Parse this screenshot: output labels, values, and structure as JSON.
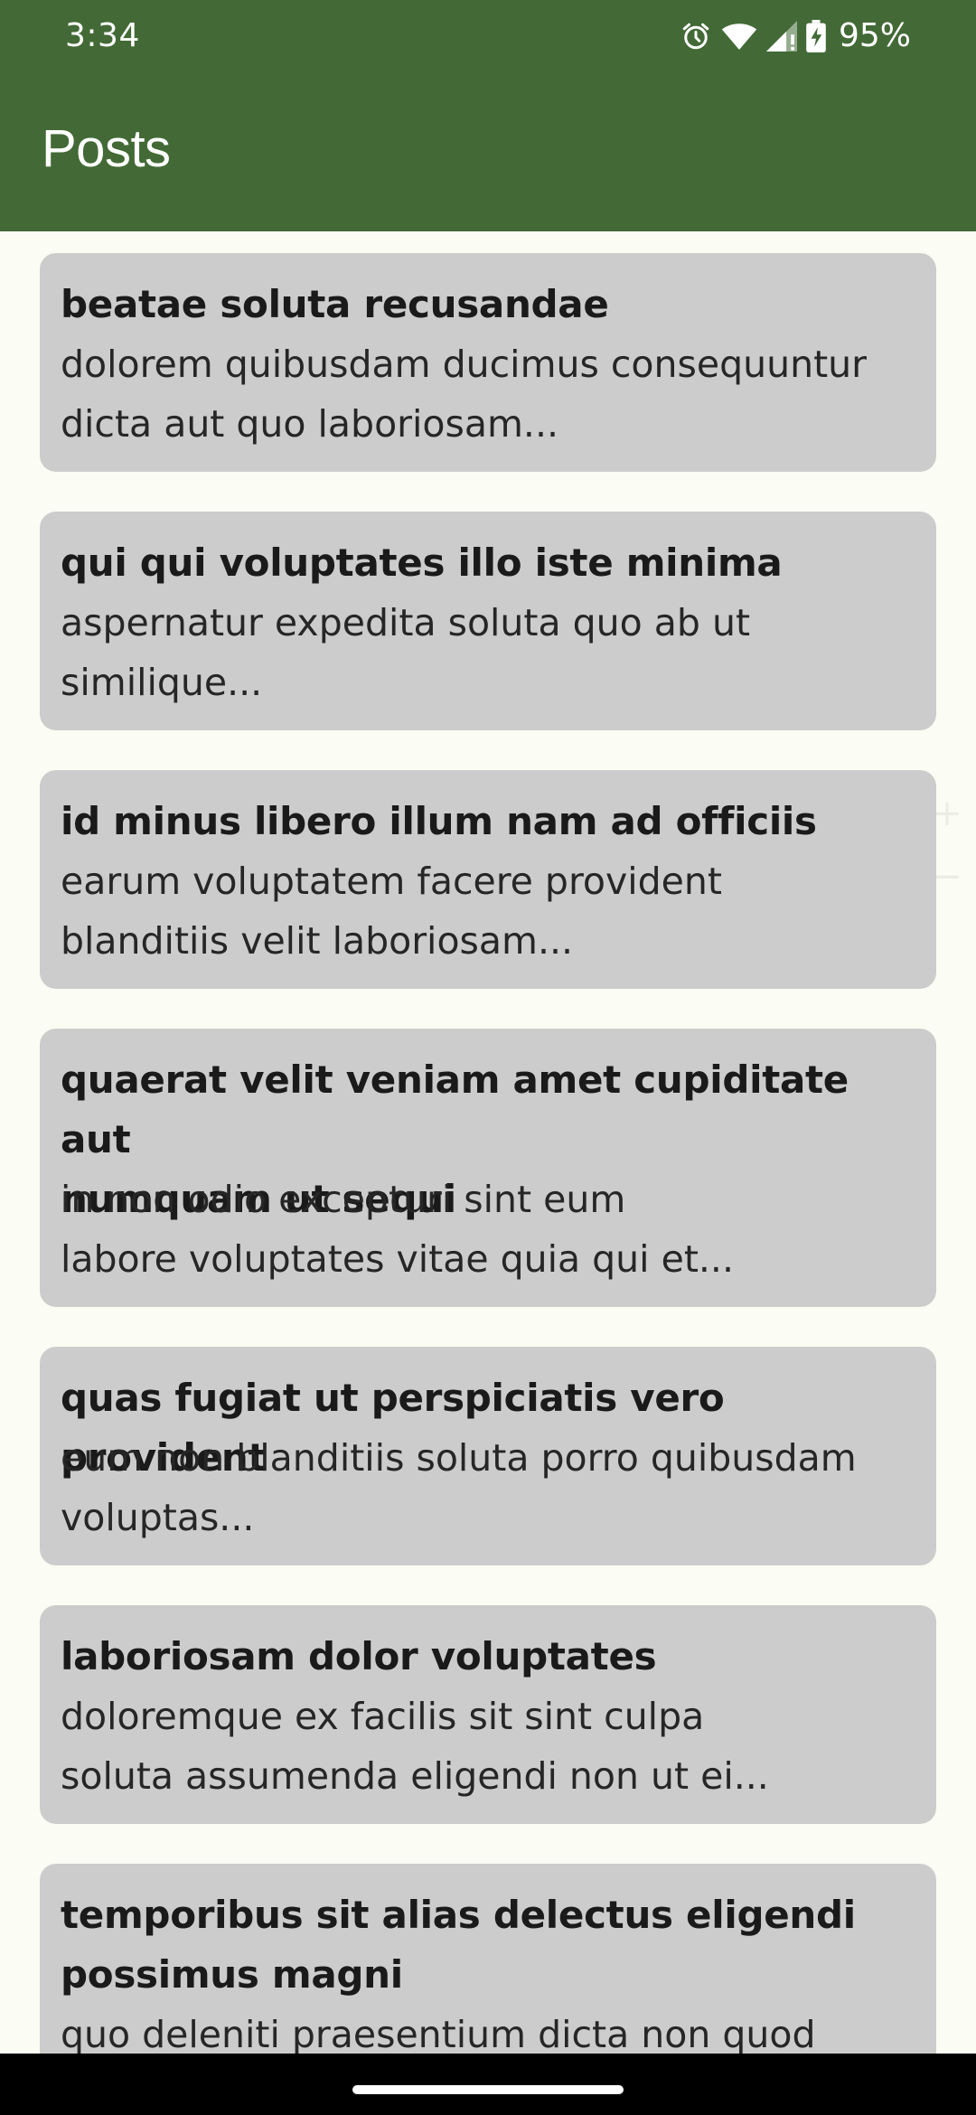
{
  "status_bar": {
    "time": "3:34",
    "battery_percent": "95%",
    "icons": [
      "alarm-icon",
      "wifi-icon",
      "signal-icon",
      "battery-charging-icon"
    ]
  },
  "app_bar": {
    "title": "Posts",
    "color": "#436a36"
  },
  "posts": [
    {
      "title": "beatae soluta recusandae",
      "body": [
        "dolorem quibusdam ducimus consequuntur",
        "dicta aut quo laboriosam..."
      ]
    },
    {
      "title": "qui qui voluptates illo iste minima",
      "body": [
        "aspernatur expedita soluta quo ab ut",
        "similique..."
      ]
    },
    {
      "title": "id minus libero illum nam ad officiis",
      "body": [
        "earum voluptatem facere provident",
        "blanditiis velit laboriosam..."
      ]
    },
    {
      "title": [
        "quaerat velit veniam amet cupiditate aut",
        "numquam ut sequi"
      ],
      "body": [
        "in non odio excepturi sint eum",
        "labore voluptates vitae quia qui et..."
      ]
    },
    {
      "title": "quas fugiat ut perspiciatis vero provident",
      "body": [
        "eum non blanditiis soluta porro quibusdam",
        "voluptas..."
      ]
    },
    {
      "title": "laboriosam dolor voluptates",
      "body": [
        "doloremque ex facilis sit sint culpa",
        "soluta assumenda eligendi non ut ei..."
      ]
    },
    {
      "title": [
        "temporibus sit alias delectus eligendi",
        "possimus magni"
      ],
      "body": [
        "quo deleniti praesentium dicta non quod"
      ]
    }
  ],
  "colors": {
    "background": "#fbfcf4",
    "card": "#cccccc",
    "nav_bar": "#000000"
  }
}
